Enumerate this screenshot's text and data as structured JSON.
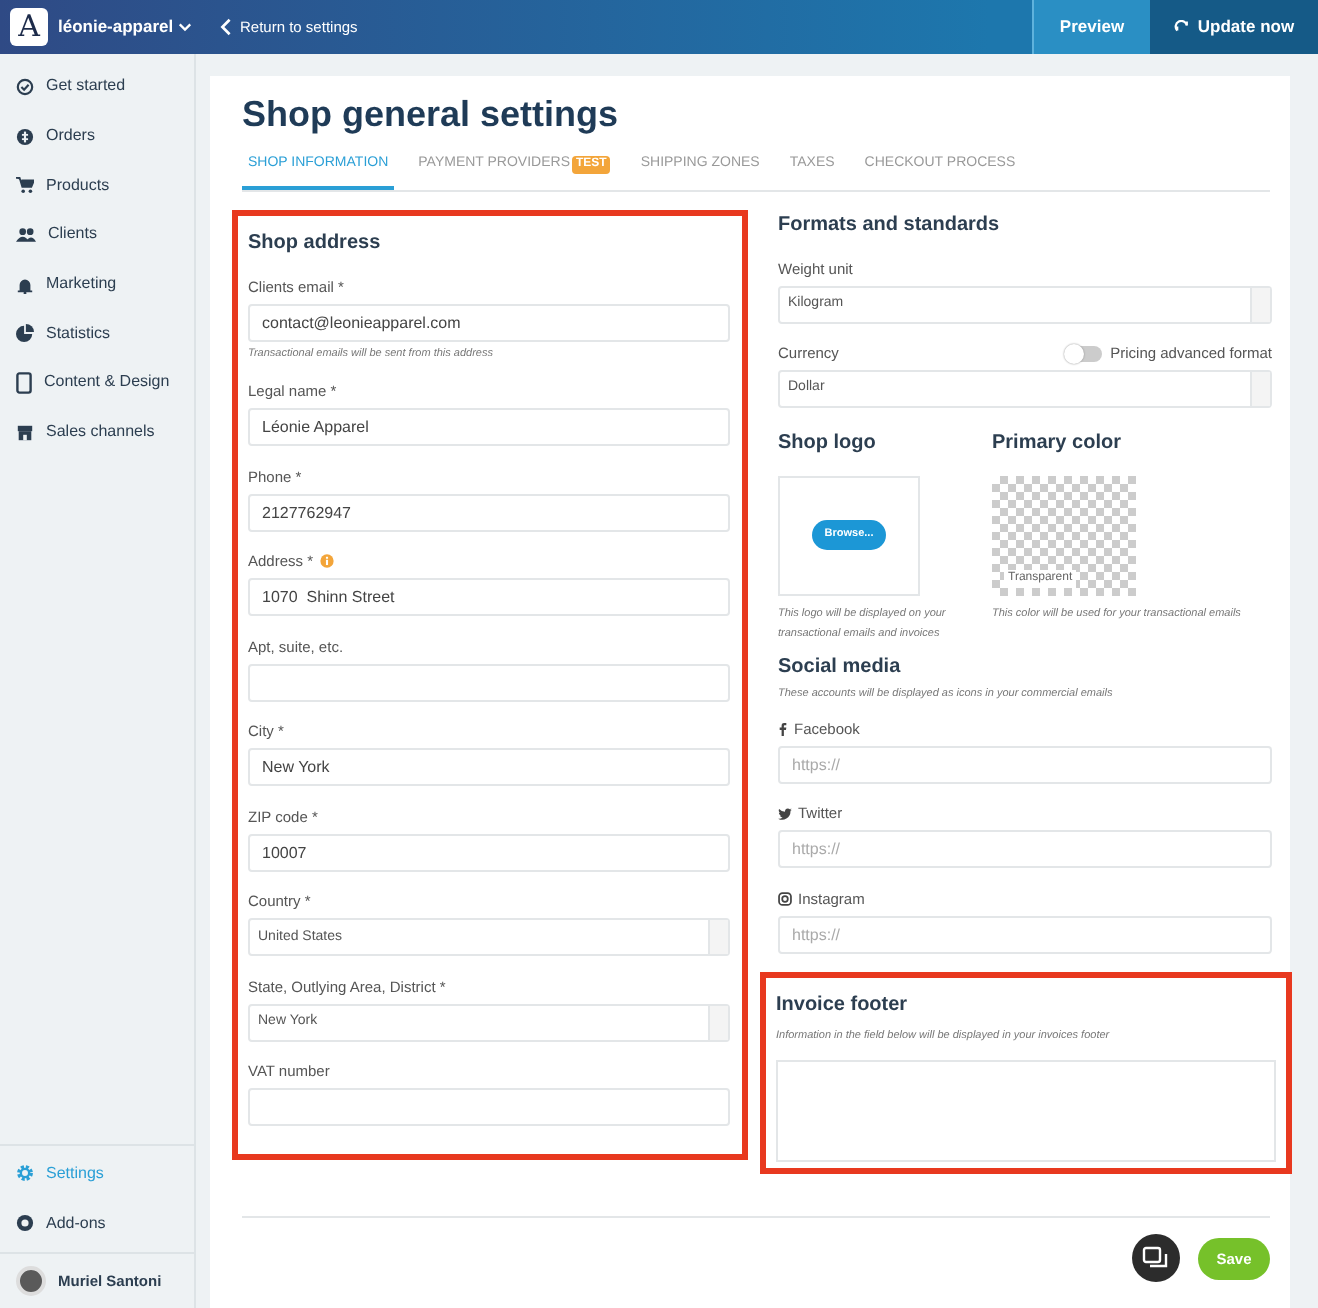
{
  "topbar": {
    "logo_letter": "A",
    "shop_name": "léonie-apparel",
    "back_link": "Return to settings",
    "preview": "Preview",
    "update": "Update now"
  },
  "sidebar": {
    "items": [
      {
        "label": "Get started",
        "selected": false
      },
      {
        "label": "Orders",
        "selected": false
      },
      {
        "label": "Products",
        "selected": false
      },
      {
        "label": "Clients",
        "selected": false
      },
      {
        "label": "Marketing",
        "selected": false
      },
      {
        "label": "Statistics",
        "selected": false
      },
      {
        "label": "Content & Design",
        "selected": false
      },
      {
        "label": "Sales channels",
        "selected": false
      }
    ],
    "bottom_items": [
      {
        "label": "Settings",
        "selected": true
      },
      {
        "label": "Add-ons",
        "selected": false
      }
    ],
    "user": {
      "name": "Muriel Santoni"
    }
  },
  "page": {
    "title": "Shop general settings",
    "tabs": [
      {
        "label": "SHOP INFORMATION",
        "selected": true
      },
      {
        "label": "PAYMENT PROVIDERS",
        "selected": false,
        "badge": "TEST"
      },
      {
        "label": "SHIPPING ZONES",
        "selected": false
      },
      {
        "label": "TAXES",
        "selected": false
      },
      {
        "label": "CHECKOUT PROCESS",
        "selected": false
      }
    ]
  },
  "shop_address": {
    "title": "Shop address",
    "highlighted": true,
    "fields": [
      {
        "kind": "text",
        "label": "Clients email *",
        "value": "contact@leonieapparel.com",
        "hint": "Transactional emails will be sent from this address"
      },
      {
        "kind": "text",
        "label": "Legal name *",
        "value": "Léonie Apparel"
      },
      {
        "kind": "text",
        "label": "Phone *",
        "value": "2127762947"
      },
      {
        "kind": "text",
        "label": "Address *",
        "value": "1070  Shinn Street",
        "info": true
      },
      {
        "kind": "text",
        "label": "Apt, suite, etc."
      },
      {
        "kind": "text",
        "label": "City *",
        "value": "New York"
      },
      {
        "kind": "text",
        "label": "ZIP code *",
        "value": "10007"
      },
      {
        "kind": "select",
        "label": "Country *",
        "value": "United States"
      },
      {
        "kind": "select",
        "label": "State, Outlying Area, District *",
        "value": "New York"
      },
      {
        "kind": "text",
        "label": "VAT number"
      }
    ]
  },
  "formats": {
    "title": "Formats and standards",
    "fields": [
      {
        "kind": "select",
        "label": "Weight unit",
        "value": "Kilogram"
      },
      {
        "kind": "select",
        "label": "Currency",
        "value": "Dollar",
        "toggle": {
          "label": "Pricing advanced format",
          "on": false
        }
      }
    ]
  },
  "shop_logo": {
    "title": "Shop logo",
    "button": "Browse...",
    "caption": "This logo will be displayed on your transactional emails and invoices"
  },
  "primary_color": {
    "title": "Primary color",
    "swatch_label": "Transparent",
    "caption": "This color will be used for your transactional emails"
  },
  "social_media": {
    "title": "Social media",
    "hint": "These accounts will be displayed as icons in your commercial emails",
    "fields": [
      {
        "kind": "facebook",
        "label": "Facebook",
        "placeholder": "https://"
      },
      {
        "kind": "twitter",
        "label": "Twitter",
        "placeholder": "https://"
      },
      {
        "kind": "instagram",
        "label": "Instagram",
        "placeholder": "https://"
      }
    ]
  },
  "invoice_footer": {
    "title": "Invoice footer",
    "highlighted": true,
    "hint": "Information in the field below will be displayed in your invoices footer"
  },
  "footer": {
    "save": "Save"
  }
}
